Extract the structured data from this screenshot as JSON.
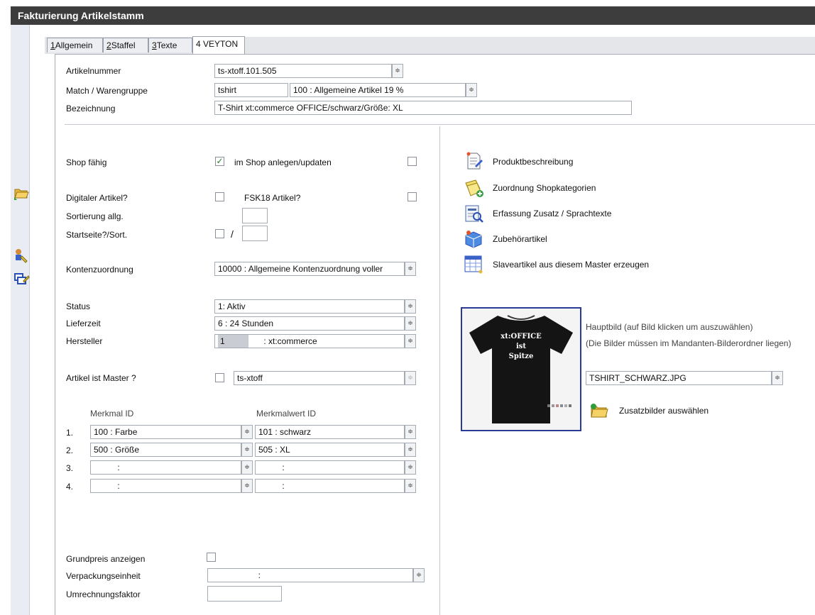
{
  "window": {
    "title": "Fakturierung Artikelstamm"
  },
  "tabs": [
    {
      "key": "1",
      "label": "Allgemein"
    },
    {
      "key": "2",
      "label": "Staffel"
    },
    {
      "key": "3",
      "label": "Texte"
    },
    {
      "key": "4",
      "label": "VEYTON"
    }
  ],
  "header": {
    "artikelnummer_label": "Artikelnummer",
    "artikelnummer": "ts-xtoff.101.505",
    "match_label": "Match / Warengruppe",
    "match": "tshirt",
    "warengruppe": "100     : Allgemeine Artikel 19 %",
    "bezeichnung_label": "Bezeichnung",
    "bezeichnung": "T-Shirt xt:commerce OFFICE/schwarz/Größe: XL"
  },
  "shop": {
    "shop_faehig_label": "Shop fähig",
    "shop_faehig_checked": true,
    "check_mark": "✓",
    "im_shop_label": "im Shop anlegen/updaten",
    "digital_label": "Digitaler Artikel?",
    "fsk18_label": "FSK18 Artikel?",
    "sortierung_label": "Sortierung allg.",
    "startseite_label": "Startseite?/Sort.",
    "slash": "/"
  },
  "konten": {
    "label": "Kontenzuordnung",
    "value": "10000  : Allgemeine Kontenzuordnung voller"
  },
  "status": {
    "status_label": "Status",
    "status_value": "1: Aktiv",
    "lieferzeit_label": "Lieferzeit",
    "lieferzeit_value": "6   : 24 Stunden",
    "hersteller_label": "Hersteller",
    "hersteller_id": "1",
    "hersteller_value": ": xt:commerce"
  },
  "master": {
    "label": "Artikel ist Master ?",
    "value": "ts-xtoff"
  },
  "merkmal": {
    "id_header": "Merkmal ID",
    "wert_header": "Merkmalwert ID",
    "rows": [
      {
        "num": "1.",
        "id": "100    : Farbe",
        "wert": "101   : schwarz"
      },
      {
        "num": "2.",
        "id": "500    : Größe",
        "wert": "505   : XL"
      },
      {
        "num": "3.",
        "id": "          :",
        "wert": "          :"
      },
      {
        "num": "4.",
        "id": "          :",
        "wert": "          :"
      }
    ]
  },
  "bottom": {
    "grundpreis_label": "Grundpreis anzeigen",
    "verpackung_label": "Verpackungseinheit",
    "verpackung_value": "                    :",
    "umrechnung_label": "Umrechnungsfaktor"
  },
  "links": [
    {
      "label": "Produktbeschreibung",
      "icon": "document-pen-icon"
    },
    {
      "label": "Zuordnung Shopkategorien",
      "icon": "category-add-icon"
    },
    {
      "label": "Erfassung Zusatz / Sprachtexte",
      "icon": "text-search-icon"
    },
    {
      "label": "Zubehörartikel",
      "icon": "box-icon"
    },
    {
      "label": "Slaveartikel aus diesem Master erzeugen",
      "icon": "grid-icon"
    }
  ],
  "image": {
    "hint1": "Hauptbild  (auf Bild klicken um auszuwählen)",
    "hint2": "(Die Bilder müssen im Mandanten-Bilderordner liegen)",
    "filename": "TSHIRT_SCHWARZ.JPG",
    "zusatz_label": "Zusatzbilder auswählen",
    "shirt_text": [
      "xt:OFFICE",
      "ist",
      "Spitze"
    ]
  },
  "spin_glyph": "≑",
  "colors": {
    "titlebar": "#3d3d3d",
    "image_border": "#2a3b96",
    "check": "#1e7d2f"
  }
}
